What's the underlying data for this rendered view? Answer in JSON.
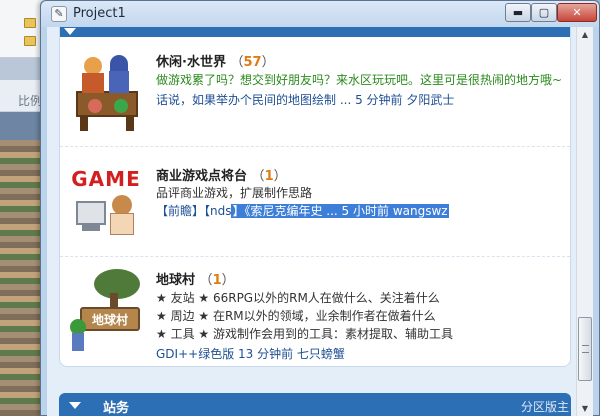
{
  "background": {
    "partial_text": "比例"
  },
  "window": {
    "title": "Project1",
    "icon_glyph": "✎",
    "buttons": {
      "minimize": "▬",
      "maximize": "▢",
      "close": "✕"
    }
  },
  "forums": [
    {
      "name": "休闲·水世界",
      "count_open": "（",
      "count": "57",
      "count_close": "）",
      "desc_line1": "做游戏累了吗？想交到好朋友吗？来水区玩玩吧。这里可是很热闹的地方哦~",
      "last_post": "话说，如果举办个民间的地图绘制 ...  5 分钟前  夕阳武士"
    },
    {
      "name": "商业游戏点将台",
      "count_open": "（",
      "count": "1",
      "count_close": "）",
      "desc_line1": "品评商业游戏，扩展制作思路",
      "last_post_unselected": "【前瞻】【nds",
      "last_post_selected": "】《索尼克编年史 ...  5 小时前  wangswz",
      "thumb_label": "GAME"
    },
    {
      "name": "地球村",
      "count_open": "（",
      "count": "1",
      "count_close": "）",
      "desc_lines": [
        "★ 友站 ★ 66RPG以外的RM人在做什么、关注着什么",
        "★ 周边 ★ 在RM以外的领域，业余制作者在做着什么",
        "★ 工具 ★ 游戏制作会用到的工具：素材提取、辅助工具"
      ],
      "last_post": "GDI++绿色版  13 分钟前  七只螃蟹",
      "thumb_label": "地球村"
    }
  ],
  "category": {
    "title": "站务",
    "right_text": "分区版主"
  },
  "colors": {
    "header_blue": "#2d6fb4",
    "count_orange": "#e07a12",
    "desc_green": "#2a8a1c",
    "link_blue": "#1f4f95",
    "selection": "#3d7fd8"
  }
}
